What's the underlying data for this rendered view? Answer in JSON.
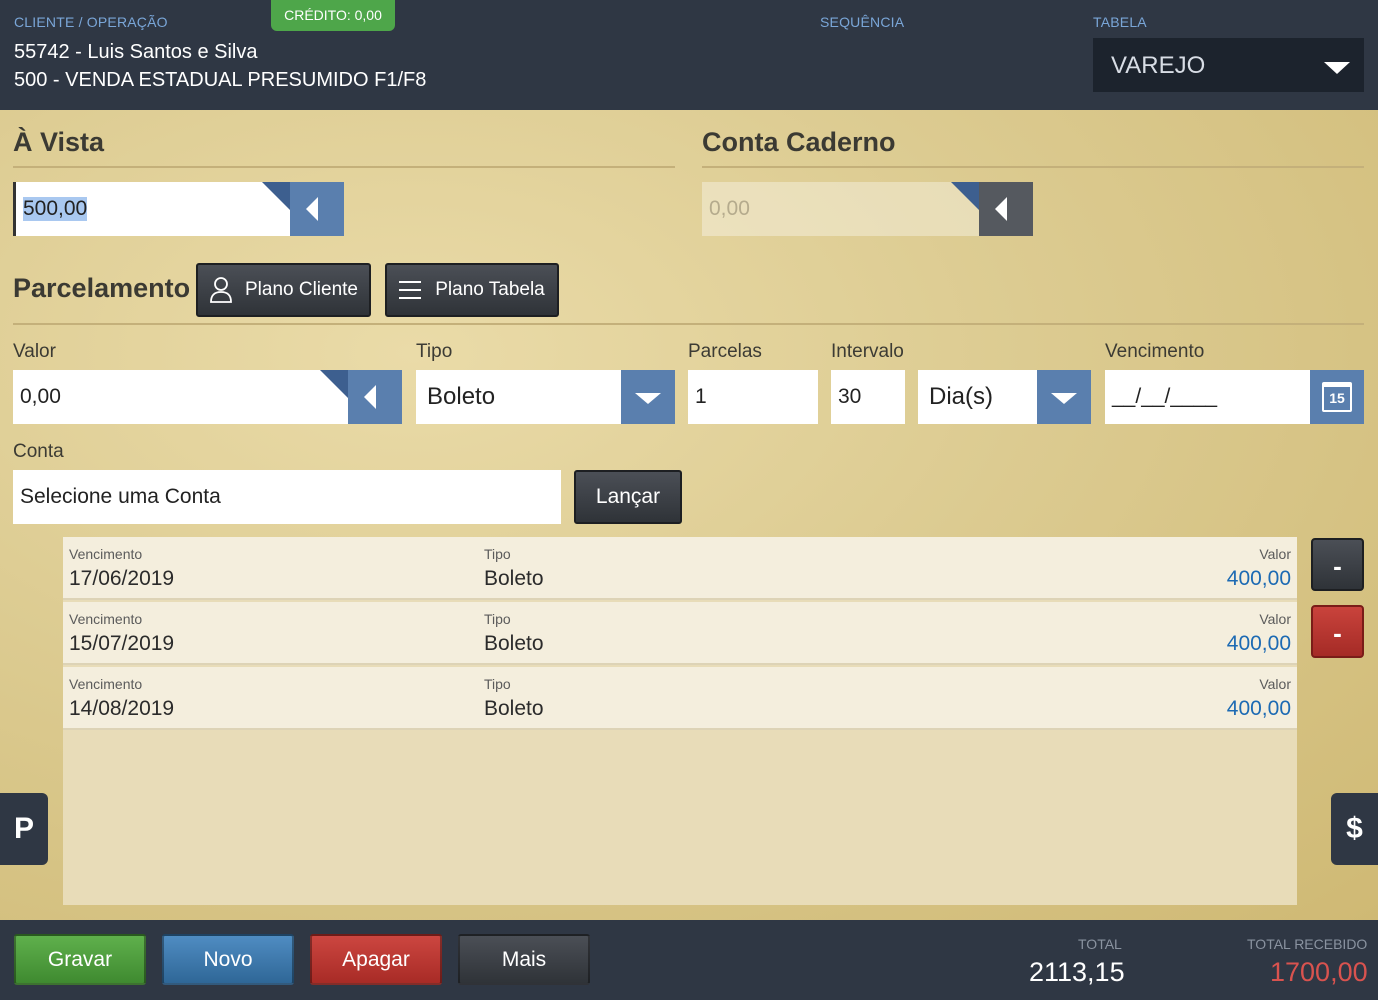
{
  "header": {
    "cliente_label": "CLIENTE / OPERAÇÃO",
    "credito": "CRÉDITO:  0,00",
    "sequencia_label": "SEQUÊNCIA",
    "tabela_label": "TABELA",
    "cliente": "55742 - Luis Santos e Silva",
    "operacao": "500 - VENDA ESTADUAL PRESUMIDO F1/F8",
    "tabela_value": "VAREJO"
  },
  "a_vista": {
    "title": "À Vista",
    "value": "500,00"
  },
  "conta_caderno": {
    "title": "Conta Caderno",
    "placeholder": "0,00"
  },
  "parcelamento": {
    "title": "Parcelamento",
    "plano_cliente_label": "Plano Cliente",
    "plano_tabela_label": "Plano Tabela",
    "valor_label": "Valor",
    "valor_value": "0,00",
    "tipo_label": "Tipo",
    "tipo_value": "Boleto",
    "parcelas_label": "Parcelas",
    "parcelas_value": "1",
    "intervalo_label": "Intervalo",
    "intervalo_value": "30",
    "intervalo_unit": "Dia(s)",
    "vencimento_label": "Vencimento",
    "vencimento_value": "__/__/____",
    "calendar_day": "15",
    "conta_label": "Conta",
    "conta_value": "Selecione uma Conta",
    "lancar_label": "Lançar"
  },
  "installments": [
    {
      "venc_cap": "Vencimento",
      "venc": "17/06/2019",
      "tipo_cap": "Tipo",
      "tipo": "Boleto",
      "valor_cap": "Valor",
      "valor": "400,00"
    },
    {
      "venc_cap": "Vencimento",
      "venc": "15/07/2019",
      "tipo_cap": "Tipo",
      "tipo": "Boleto",
      "valor_cap": "Valor",
      "valor": "400,00"
    },
    {
      "venc_cap": "Vencimento",
      "venc": "14/08/2019",
      "tipo_cap": "Tipo",
      "tipo": "Boleto",
      "valor_cap": "Valor",
      "valor": "400,00"
    }
  ],
  "side": {
    "minus_dark": "-",
    "minus_red": "-",
    "left_tab": "P",
    "right_tab": "$"
  },
  "footer": {
    "gravar": "Gravar",
    "novo": "Novo",
    "apagar": "Apagar",
    "mais": "Mais",
    "total_label": "TOTAL",
    "total_value": "2113,15",
    "recebido_label": "TOTAL RECEBIDO",
    "recebido_value": "1700,00"
  },
  "colors": {
    "header_bg": "#2f3744",
    "accent_blue": "#5a7fae",
    "credit_green": "#4ea64a",
    "gravar_green": "#4e9a3c",
    "novo_blue": "#3f78ad",
    "apagar_red": "#b83530",
    "recebido_red": "#d9534f"
  }
}
